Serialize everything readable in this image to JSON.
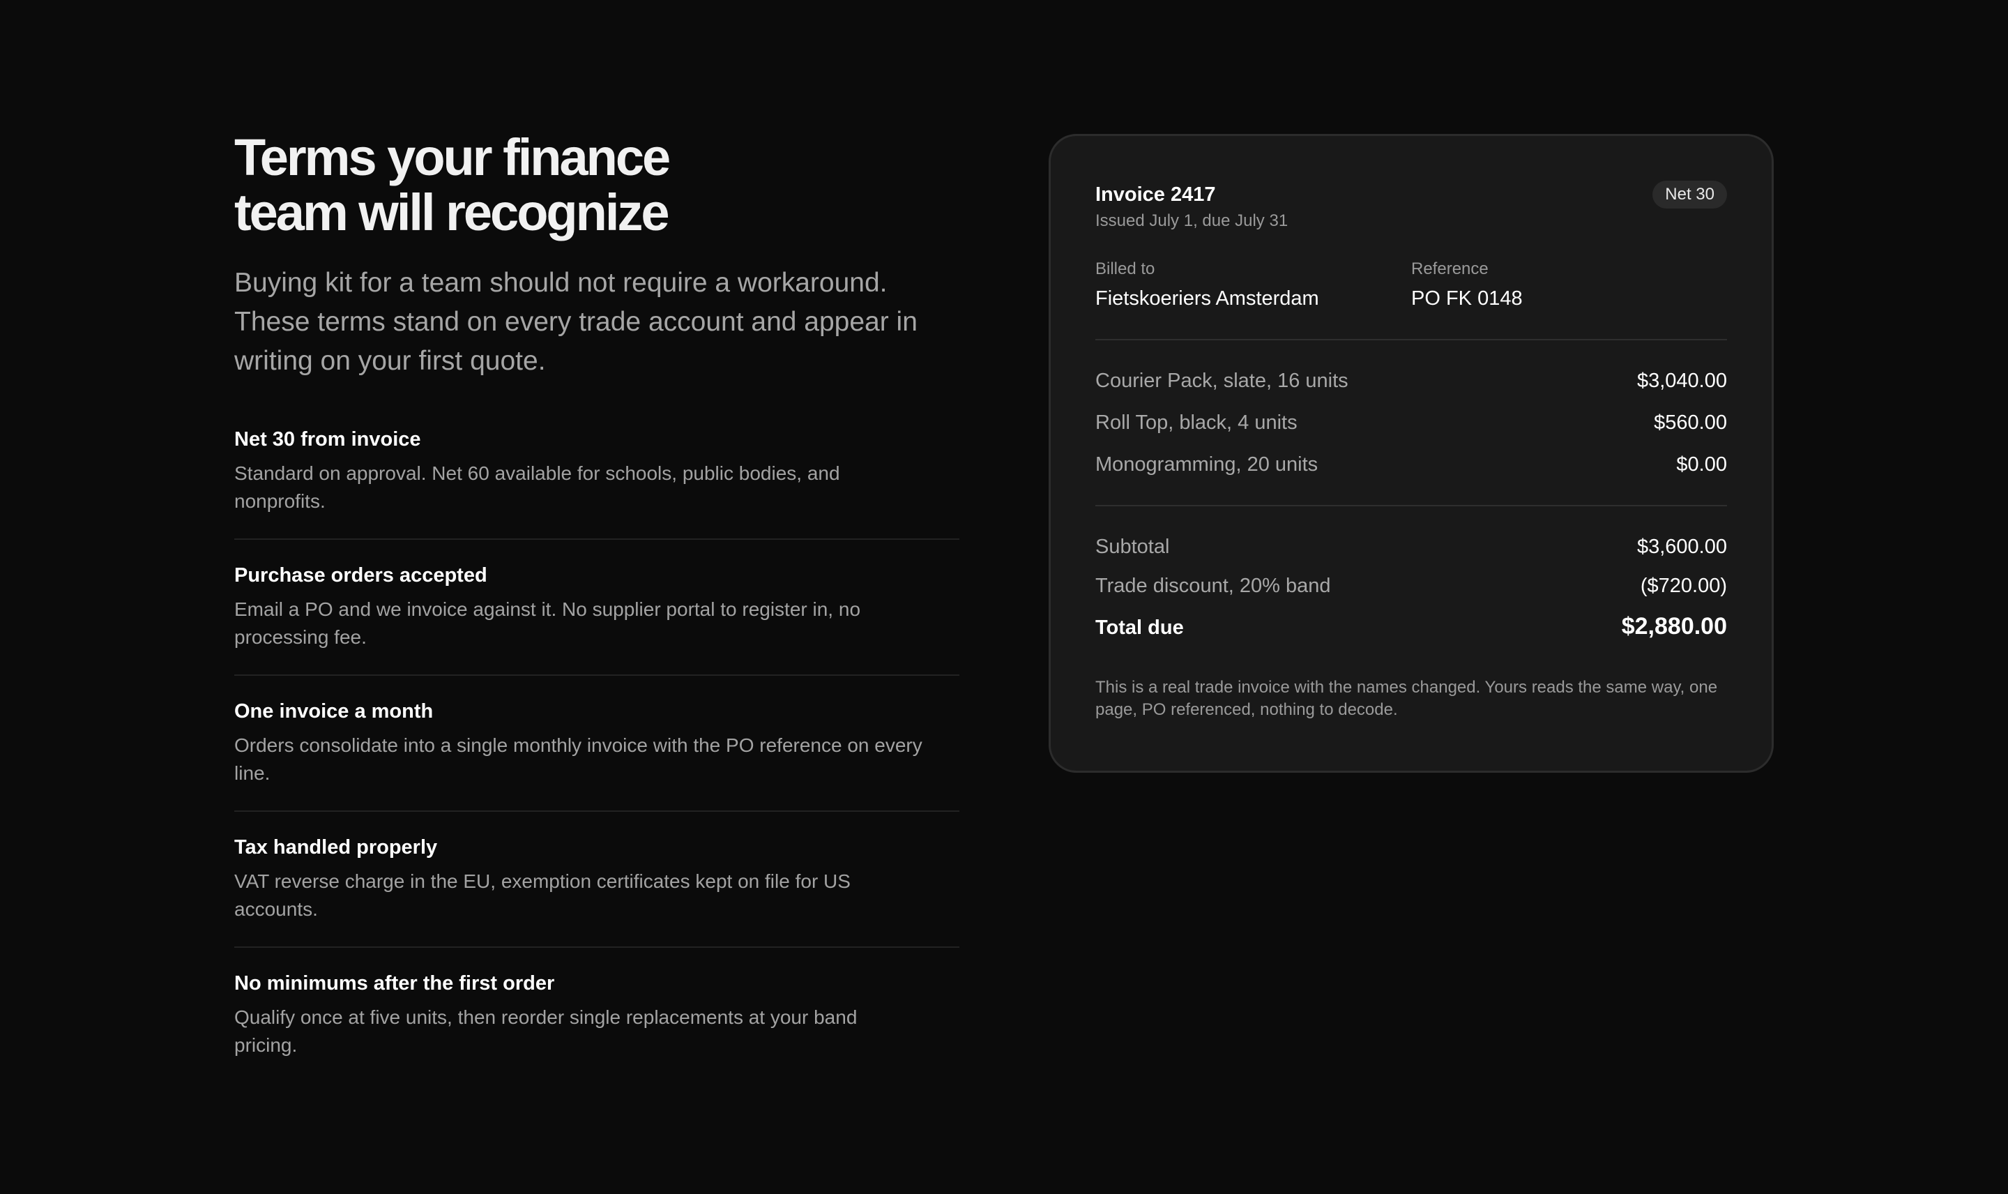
{
  "heading": {
    "line1": "Terms your finance",
    "line2": "team will recognize"
  },
  "lede": "Buying kit for a team should not require a workaround. These terms stand on every trade account and appear in writing on your first quote.",
  "terms": [
    {
      "title": "Net 30 from invoice",
      "description": "Standard on approval. Net 60 available for schools, public bodies, and nonprofits."
    },
    {
      "title": "Purchase orders accepted",
      "description": "Email a PO and we invoice against it. No supplier portal to register in, no processing fee."
    },
    {
      "title": "One invoice a month",
      "description": "Orders consolidate into a single monthly invoice with the PO reference on every line."
    },
    {
      "title": "Tax handled properly",
      "description": "VAT reverse charge in the EU, exemption certificates kept on file for US accounts."
    },
    {
      "title": "No minimums after the first order",
      "description": "Qualify once at five units, then reorder single replacements at your band pricing."
    }
  ],
  "invoice": {
    "title": "Invoice 2417",
    "dates": "Issued July 1, due July 31",
    "badge": "Net 30",
    "billed_to_label": "Billed to",
    "billed_to": "Fietskoeriers Amsterdam",
    "reference_label": "Reference",
    "reference": "PO FK 0148",
    "lines": [
      {
        "description": "Courier Pack, slate, 16 units",
        "amount": "$3,040.00"
      },
      {
        "description": "Roll Top, black, 4 units",
        "amount": "$560.00"
      },
      {
        "description": "Monogramming, 20 units",
        "amount": "$0.00"
      }
    ],
    "subtotal_label": "Subtotal",
    "subtotal": "$3,600.00",
    "discount_label": "Trade discount, 20% band",
    "discount": "($720.00)",
    "total_label": "Total due",
    "total": "$2,880.00",
    "note": "This is a real trade invoice with the names changed. Yours reads the same way, one page, PO referenced, nothing to decode."
  }
}
